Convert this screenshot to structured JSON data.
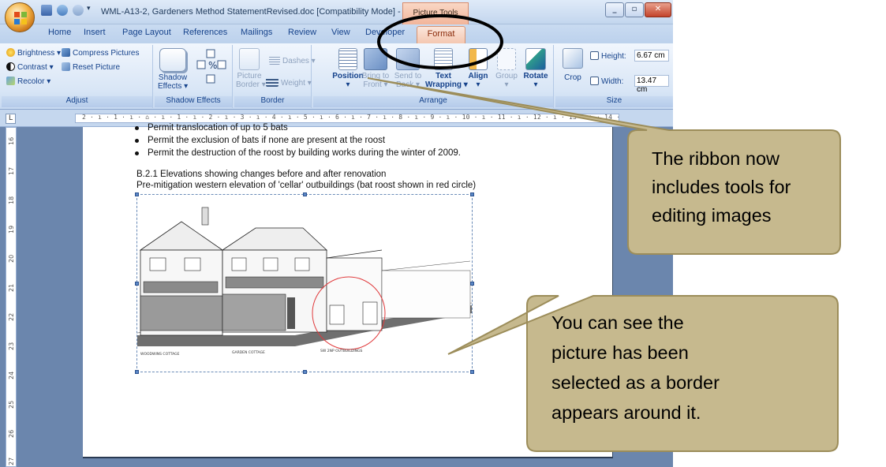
{
  "window": {
    "title": "WML-A13-2, Gardeners Method StatementRevised.doc [Compatibility Mode] - M...",
    "context_tab": "Picture Tools"
  },
  "tabs": [
    "Home",
    "Insert",
    "Page Layout",
    "References",
    "Mailings",
    "Review",
    "View",
    "Developer",
    "Format"
  ],
  "ribbon": {
    "adjust": {
      "label": "Adjust",
      "brightness": "Brightness ▾",
      "contrast": "Contrast ▾",
      "recolor": "Recolor ▾",
      "compress": "Compress Pictures",
      "reset": "Reset Picture"
    },
    "shadow": {
      "label": "Shadow Effects",
      "button_line1": "Shadow",
      "button_line2": "Effects ▾"
    },
    "border": {
      "label": "Border",
      "dashes": "Dashes ▾",
      "weight": "Weight ▾",
      "picture_border_line1": "Picture",
      "picture_border_line2": "Border ▾"
    },
    "arrange": {
      "label": "Arrange",
      "position": "Position",
      "bring_line1": "Bring to",
      "bring_line2": "Front ▾",
      "send_line1": "Send to",
      "send_line2": "Back ▾",
      "text_line1": "Text",
      "text_line2": "Wrapping ▾",
      "align": "Align",
      "group": "Group",
      "rotate": "Rotate"
    },
    "size": {
      "label": "Size",
      "crop": "Crop",
      "height_label": "Height:",
      "height_value": "6.67 cm",
      "width_label": "Width:",
      "width_value": "13.47 cm"
    }
  },
  "ruler": {
    "horizontal": "2 · ı · 1 · ı · ⌂ · ı · 1 · ı · 2 · ı · 3 · ı · 4 · ı · 5 · ı · 6 · ı · 7 · ı · 8 · ı · 9 · ı · 10 · ı · 11 · ı · 12 · ı · 13 · ı · 14 · ı · 15 · ı · 16 · ı · ⌂ · ı · 18 · ı ·",
    "vertical": [
      "16",
      "17",
      "18",
      "19",
      "20",
      "21",
      "22",
      "23",
      "24",
      "25",
      "26",
      "27"
    ],
    "corner": "L"
  },
  "document": {
    "bullets": [
      "Permit translocation of up to 5 bats",
      "Permit the exclusion of bats if none are present at the roost",
      "Permit the destruction of the roost by building works during the winter of 2009."
    ],
    "heading": "B.2.1 Elevations showing changes before and after renovation",
    "subheading": "Pre-mitigation western elevation of 'cellar' outbuildings (bat roost shown in red circle)",
    "picture_labels": [
      "WOODWINS COTTAGE",
      "GARDEN COTTAGE",
      "SW 2NP OUTBUILDINGS"
    ]
  },
  "callouts": {
    "ribbon": [
      "The ribbon now",
      "includes tools for",
      "editing images"
    ],
    "picture": [
      "You can see the",
      "picture has been",
      "selected as a border",
      "appears around it."
    ]
  },
  "colors": {
    "callout_fill": "#c6b98e",
    "callout_border": "#9c8d5a",
    "annotation_circle": "#000000",
    "roost_circle": "#e0393b",
    "format_tab": "#f4c7b1"
  }
}
